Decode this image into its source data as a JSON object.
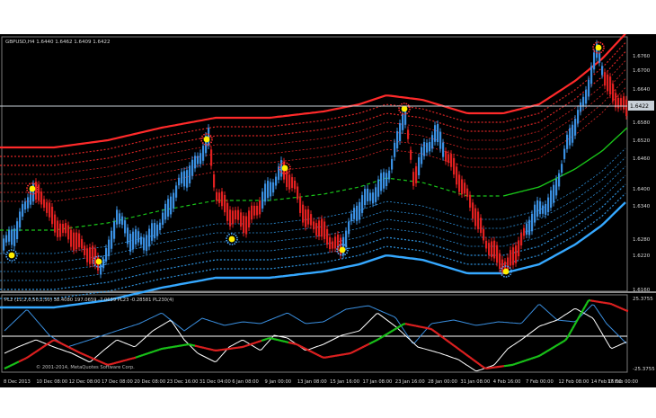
{
  "chart": {
    "symbol_line": "GBPUSD,H4  1.6440 1.6462 1.6409 1.6422",
    "current_price": "1.6422",
    "watermark": "© 2001-2014, MetaQuotes Software Corp.",
    "indicator_label": "PL2 (11,2,0,50,2,50) 38.4080 197.0659 -7.0639 PL23 -0.28581 PL230(4)"
  },
  "price_axis": {
    "ticks": [
      "1.6760",
      "1.6700",
      "1.6640",
      "1.6580",
      "1.6520",
      "1.6460",
      "1.6400",
      "1.6340",
      "1.6280",
      "1.6220",
      "1.6160"
    ]
  },
  "osc_axis": {
    "top": "25.3755",
    "bottom": "-25.3755"
  },
  "time_axis": {
    "labels": [
      "8 Dec 2013",
      "10 Dec 08:00",
      "12 Dec 08:00",
      "17 Dec 08:00",
      "20 Dec 08:00",
      "23 Dec 16:00",
      "31 Dec 04:00",
      "6 Jan 08:00",
      "9 Jan 00:00",
      "13 Jan 08:00",
      "15 Jan 16:00",
      "17 Jan 08:00",
      "23 Jan 16:00",
      "28 Jan 00:00",
      "31 Jan 08:00",
      "4 Feb 16:00",
      "7 Feb 00:00",
      "12 Feb 08:00",
      "14 Feb 16:00",
      "17 Feb 00:00"
    ]
  },
  "colors": {
    "bull": "#3a8fe0",
    "bear": "#e02020",
    "upper_band": "#ff2a2a",
    "lower_band": "#35a8ff",
    "mid_line": "#19c419",
    "signal": "#ffee00",
    "osc_blue": "#3a8fe0",
    "osc_white": "#ffffff"
  }
}
